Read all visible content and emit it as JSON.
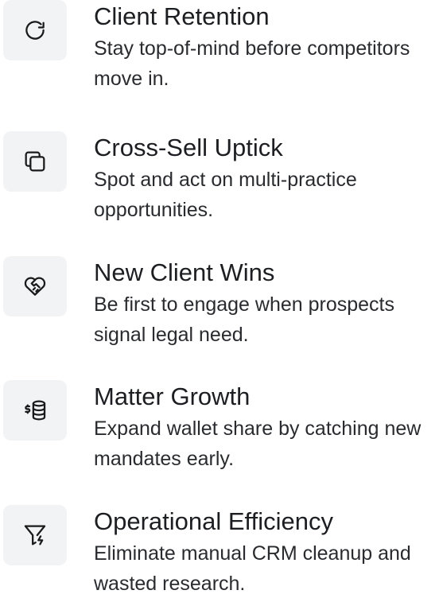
{
  "features": [
    {
      "icon": "refresh-icon",
      "title": "Client Retention",
      "description": "Stay top-of-mind before competitors move in."
    },
    {
      "icon": "copy-icon",
      "title": "Cross-Sell Uptick",
      "description": "Spot and act on multi-practice opportunities."
    },
    {
      "icon": "handshake-icon",
      "title": "New Client Wins",
      "description": "Be first to engage when prospects signal legal need."
    },
    {
      "icon": "coins-database-icon",
      "title": "Matter Growth",
      "description": "Expand wallet share by catching new mandates early."
    },
    {
      "icon": "funnel-bolt-icon",
      "title": "Operational Efficiency",
      "description": "Eliminate manual CRM cleanup and wasted research."
    }
  ]
}
